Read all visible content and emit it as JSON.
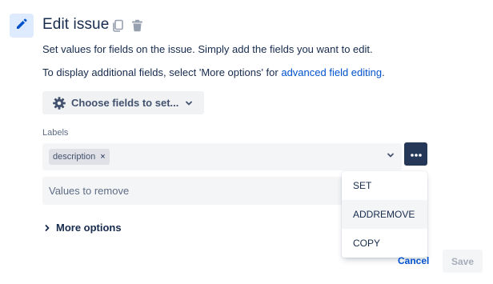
{
  "header": {
    "title": "Edit issue",
    "icon": "pencil-icon",
    "actions": [
      "copy-icon",
      "trash-icon"
    ],
    "icon_bg": "#deebff",
    "icon_color": "#0052cc"
  },
  "description": {
    "line1": "Set values for fields on the issue. Simply add the fields you want to edit.",
    "line2_prefix": "To display additional fields, select 'More options' for ",
    "line2_link": "advanced field editing",
    "line2_suffix": "."
  },
  "choose_fields": {
    "label": "Choose fields to set...",
    "icon": "gear-icon"
  },
  "labels_field": {
    "label": "Labels",
    "tags": [
      "description"
    ],
    "tag_remove": "×"
  },
  "remove_field": {
    "placeholder": "Values to remove"
  },
  "more_options": {
    "label": "More options"
  },
  "dropdown": {
    "items": [
      "SET",
      "ADDREMOVE",
      "COPY"
    ],
    "active_item": "ADDREMOVE"
  },
  "footer": {
    "cancel_label": "Cancel",
    "save_label": "Save"
  },
  "colors": {
    "accent": "#0052cc",
    "dark_button": "#253858",
    "text": "#172b4d"
  }
}
